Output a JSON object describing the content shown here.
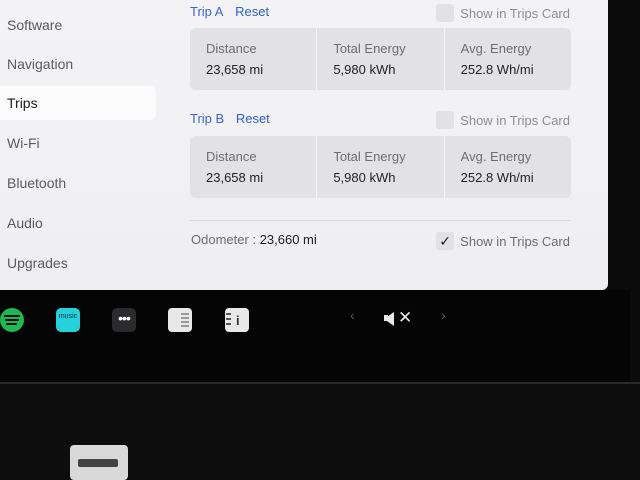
{
  "sidebar": {
    "items": [
      {
        "label": "Software"
      },
      {
        "label": "Navigation"
      },
      {
        "label": "Trips"
      },
      {
        "label": "Wi-Fi"
      },
      {
        "label": "Bluetooth"
      },
      {
        "label": "Audio"
      },
      {
        "label": "Upgrades"
      }
    ],
    "active": "Trips"
  },
  "trip_a": {
    "name": "Trip A",
    "reset_label": "Reset",
    "show_label": "Show in Trips Card",
    "show_checked": false,
    "distance_label": "Distance",
    "distance_value": "23,658 mi",
    "energy_label": "Total Energy",
    "energy_value": "5,980 kWh",
    "avg_label": "Avg. Energy",
    "avg_value": "252.8 Wh/mi"
  },
  "trip_b": {
    "name": "Trip B",
    "reset_label": "Reset",
    "show_label": "Show in Trips Card",
    "show_checked": false,
    "distance_label": "Distance",
    "distance_value": "23,658 mi",
    "energy_label": "Total Energy",
    "energy_value": "5,980 kWh",
    "avg_label": "Avg. Energy",
    "avg_value": "252.8 Wh/mi"
  },
  "odometer": {
    "label": "Odometer",
    "separator": ":",
    "value": "23,660 mi",
    "show_label": "Show in Trips Card",
    "show_checked": true,
    "check_glyph": "✓"
  },
  "dock": {
    "icons": [
      "spotify-icon",
      "amazon-music-icon",
      "more-apps-icon",
      "toybox-icon",
      "owners-manual-icon",
      "chevron-left-icon",
      "volume-muted-icon",
      "chevron-right-icon"
    ],
    "amazon_text": "music",
    "more_glyph": "•••",
    "manual_glyph": "i",
    "left_arrow": "‹",
    "right_arrow": "›",
    "mute_glyph": "✕"
  },
  "colors": {
    "link": "#2f5fd0",
    "screen_bg": "#f2f2f4",
    "card_bg": "#e2e2e5",
    "spotify": "#1db954",
    "amazon": "#25d1da"
  }
}
